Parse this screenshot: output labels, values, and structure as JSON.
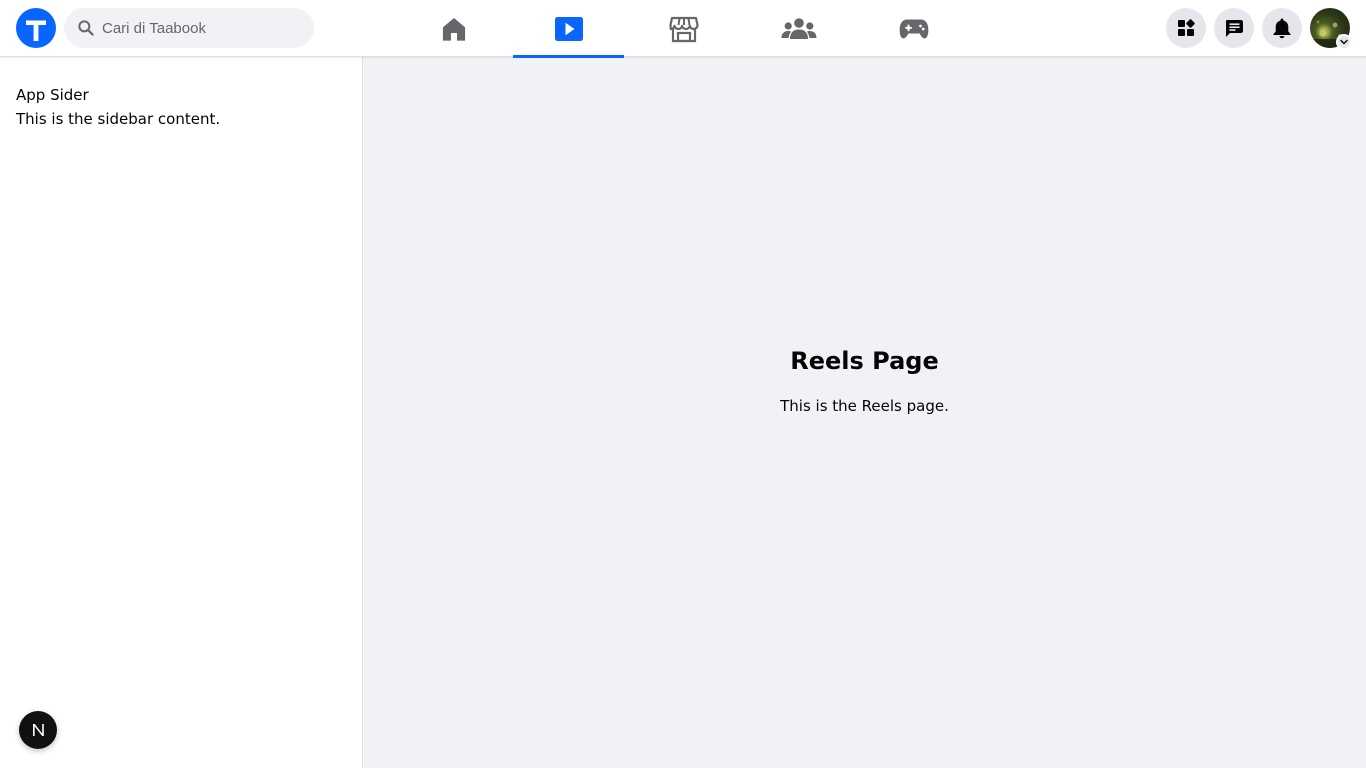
{
  "app": {
    "logo_icon": "taabook-logo-icon",
    "accent_color": "#0866ff"
  },
  "search": {
    "placeholder": "Cari di Taabook",
    "icon": "search-icon"
  },
  "nav": {
    "tabs": [
      {
        "id": "home",
        "icon": "home-icon",
        "active": false
      },
      {
        "id": "reels",
        "icon": "video-play-icon",
        "active": true
      },
      {
        "id": "marketplace",
        "icon": "store-icon",
        "active": false
      },
      {
        "id": "groups",
        "icon": "groups-icon",
        "active": false
      },
      {
        "id": "gaming",
        "icon": "gamepad-icon",
        "active": false
      }
    ]
  },
  "actions": {
    "menu_icon": "apps-grid-icon",
    "messenger_icon": "chat-icon",
    "notifications_icon": "bell-icon",
    "account_icon": "avatar",
    "account_dropdown_icon": "chevron-down-icon"
  },
  "sidebar": {
    "title": "App Sider",
    "text": "This is the sidebar content."
  },
  "main": {
    "title": "Reels Page",
    "text": "This is the Reels page."
  },
  "dev_badge": {
    "icon": "next-dev-indicator-icon",
    "letter": "N"
  }
}
